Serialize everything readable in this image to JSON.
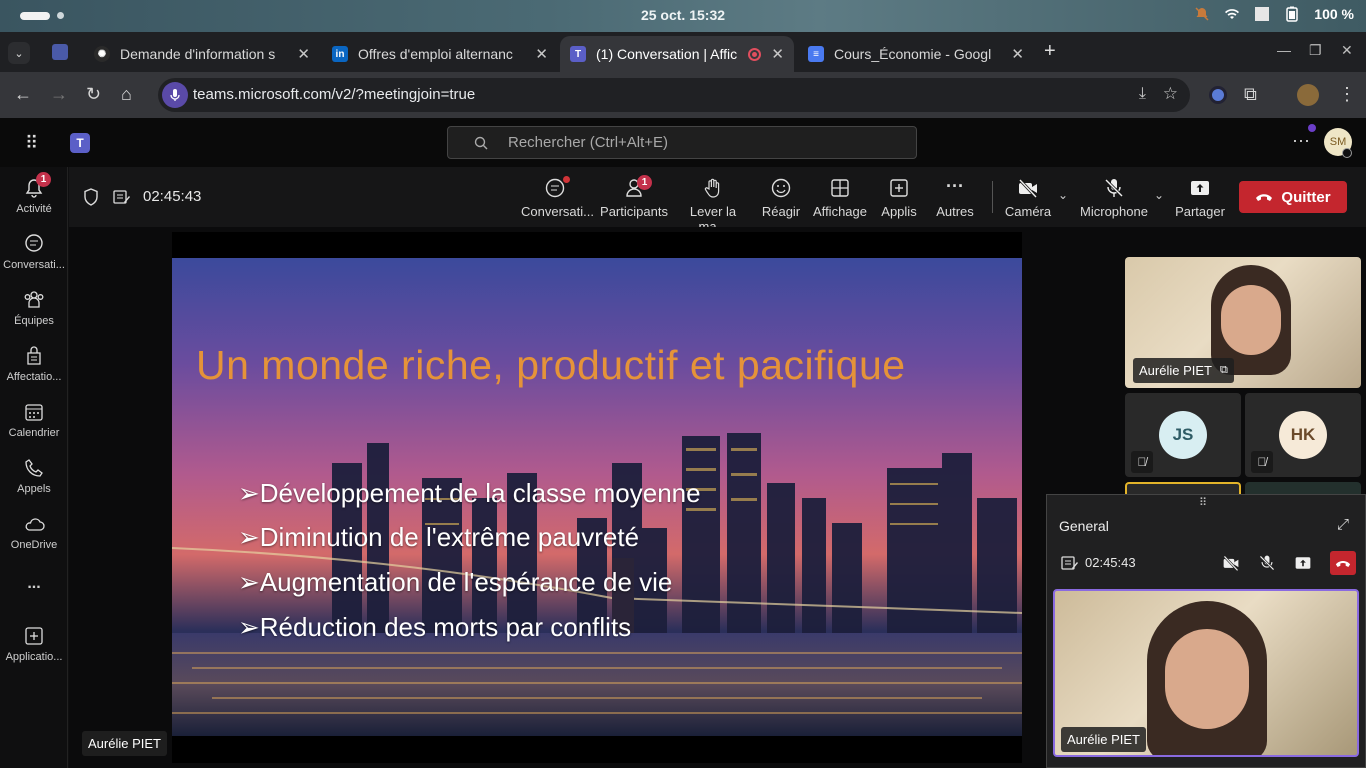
{
  "system": {
    "datetime": "25 oct.  15:32",
    "battery": "100 %"
  },
  "tabs": [
    {
      "title": "Demande d'information s",
      "favicon": "openai-icon"
    },
    {
      "title": "Offres d'emploi alternanc",
      "favicon": "linkedin-icon"
    },
    {
      "title": "(1) Conversation | Affic",
      "favicon": "teams-icon",
      "active": true
    },
    {
      "title": "Cours_Économie - Googl",
      "favicon": "google-docs-icon"
    }
  ],
  "browser": {
    "url": "teams.microsoft.com/v2/?meetingjoin=true"
  },
  "teams": {
    "search_placeholder": "Rechercher (Ctrl+Alt+E)",
    "user_initials": "SM"
  },
  "rail": [
    {
      "label": "Activité",
      "icon": "bell-icon",
      "badge": "1"
    },
    {
      "label": "Conversati...",
      "icon": "chat-icon"
    },
    {
      "label": "Équipes",
      "icon": "teams-people-icon"
    },
    {
      "label": "Affectatio...",
      "icon": "assignment-icon"
    },
    {
      "label": "Calendrier",
      "icon": "calendar-icon"
    },
    {
      "label": "Appels",
      "icon": "phone-icon"
    },
    {
      "label": "OneDrive",
      "icon": "cloud-icon"
    },
    {
      "label": "...",
      "icon": "more-icon"
    },
    {
      "label": "Applicatio...",
      "icon": "add-apps-icon"
    }
  ],
  "meeting": {
    "timer": "02:45:43",
    "controls": {
      "chat": "Conversati...",
      "participants": "Participants",
      "participants_badge": "1",
      "raise_hand": "Lever la ma...",
      "react": "Réagir",
      "view": "Affichage",
      "apps": "Applis",
      "more": "Autres",
      "camera": "Caméra",
      "mic": "Microphone",
      "share": "Partager",
      "leave": "Quitter"
    },
    "presenter_name": "Aurélie PIET"
  },
  "slide": {
    "title": "Un monde riche, productif et pacifique",
    "bullets": [
      "➢Développement de la classe moyenne",
      "➢Diminution de l'extrême pauvreté",
      "➢Augmentation de l'espérance de vie",
      "➢Réduction des morts par conflits"
    ]
  },
  "participants": [
    {
      "name": "Aurélie PIET"
    },
    {
      "initials": "JS",
      "color": "#d8eef2"
    },
    {
      "initials": "HK",
      "color": "#f6ead8"
    }
  ],
  "mini_window": {
    "title": "General",
    "timer": "02:45:43",
    "video_name": "Aurélie PIET"
  }
}
